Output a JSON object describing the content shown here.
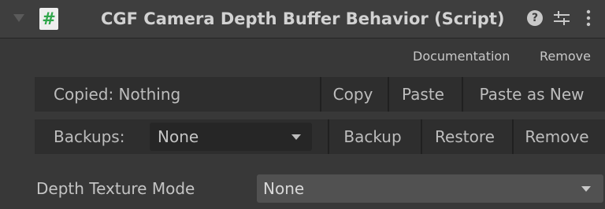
{
  "header": {
    "title": "CGF Camera Depth Buffer Behavior (Script)",
    "script_icon_glyph": "#",
    "help_icon_glyph": "?"
  },
  "links": {
    "documentation": "Documentation",
    "remove": "Remove"
  },
  "clipboard": {
    "label": "Copied: Nothing",
    "copy": "Copy",
    "paste": "Paste",
    "paste_as_new": "Paste as New"
  },
  "backups": {
    "label": "Backups:",
    "selected": "None",
    "backup": "Backup",
    "restore": "Restore",
    "remove": "Remove"
  },
  "properties": {
    "depth_texture_mode_label": "Depth Texture Mode",
    "depth_texture_mode_value": "None"
  },
  "icons": [
    "foldout-triangle-icon",
    "script-icon",
    "help-icon",
    "presets-icon",
    "context-menu-icon",
    "dropdown-arrow-icon"
  ]
}
